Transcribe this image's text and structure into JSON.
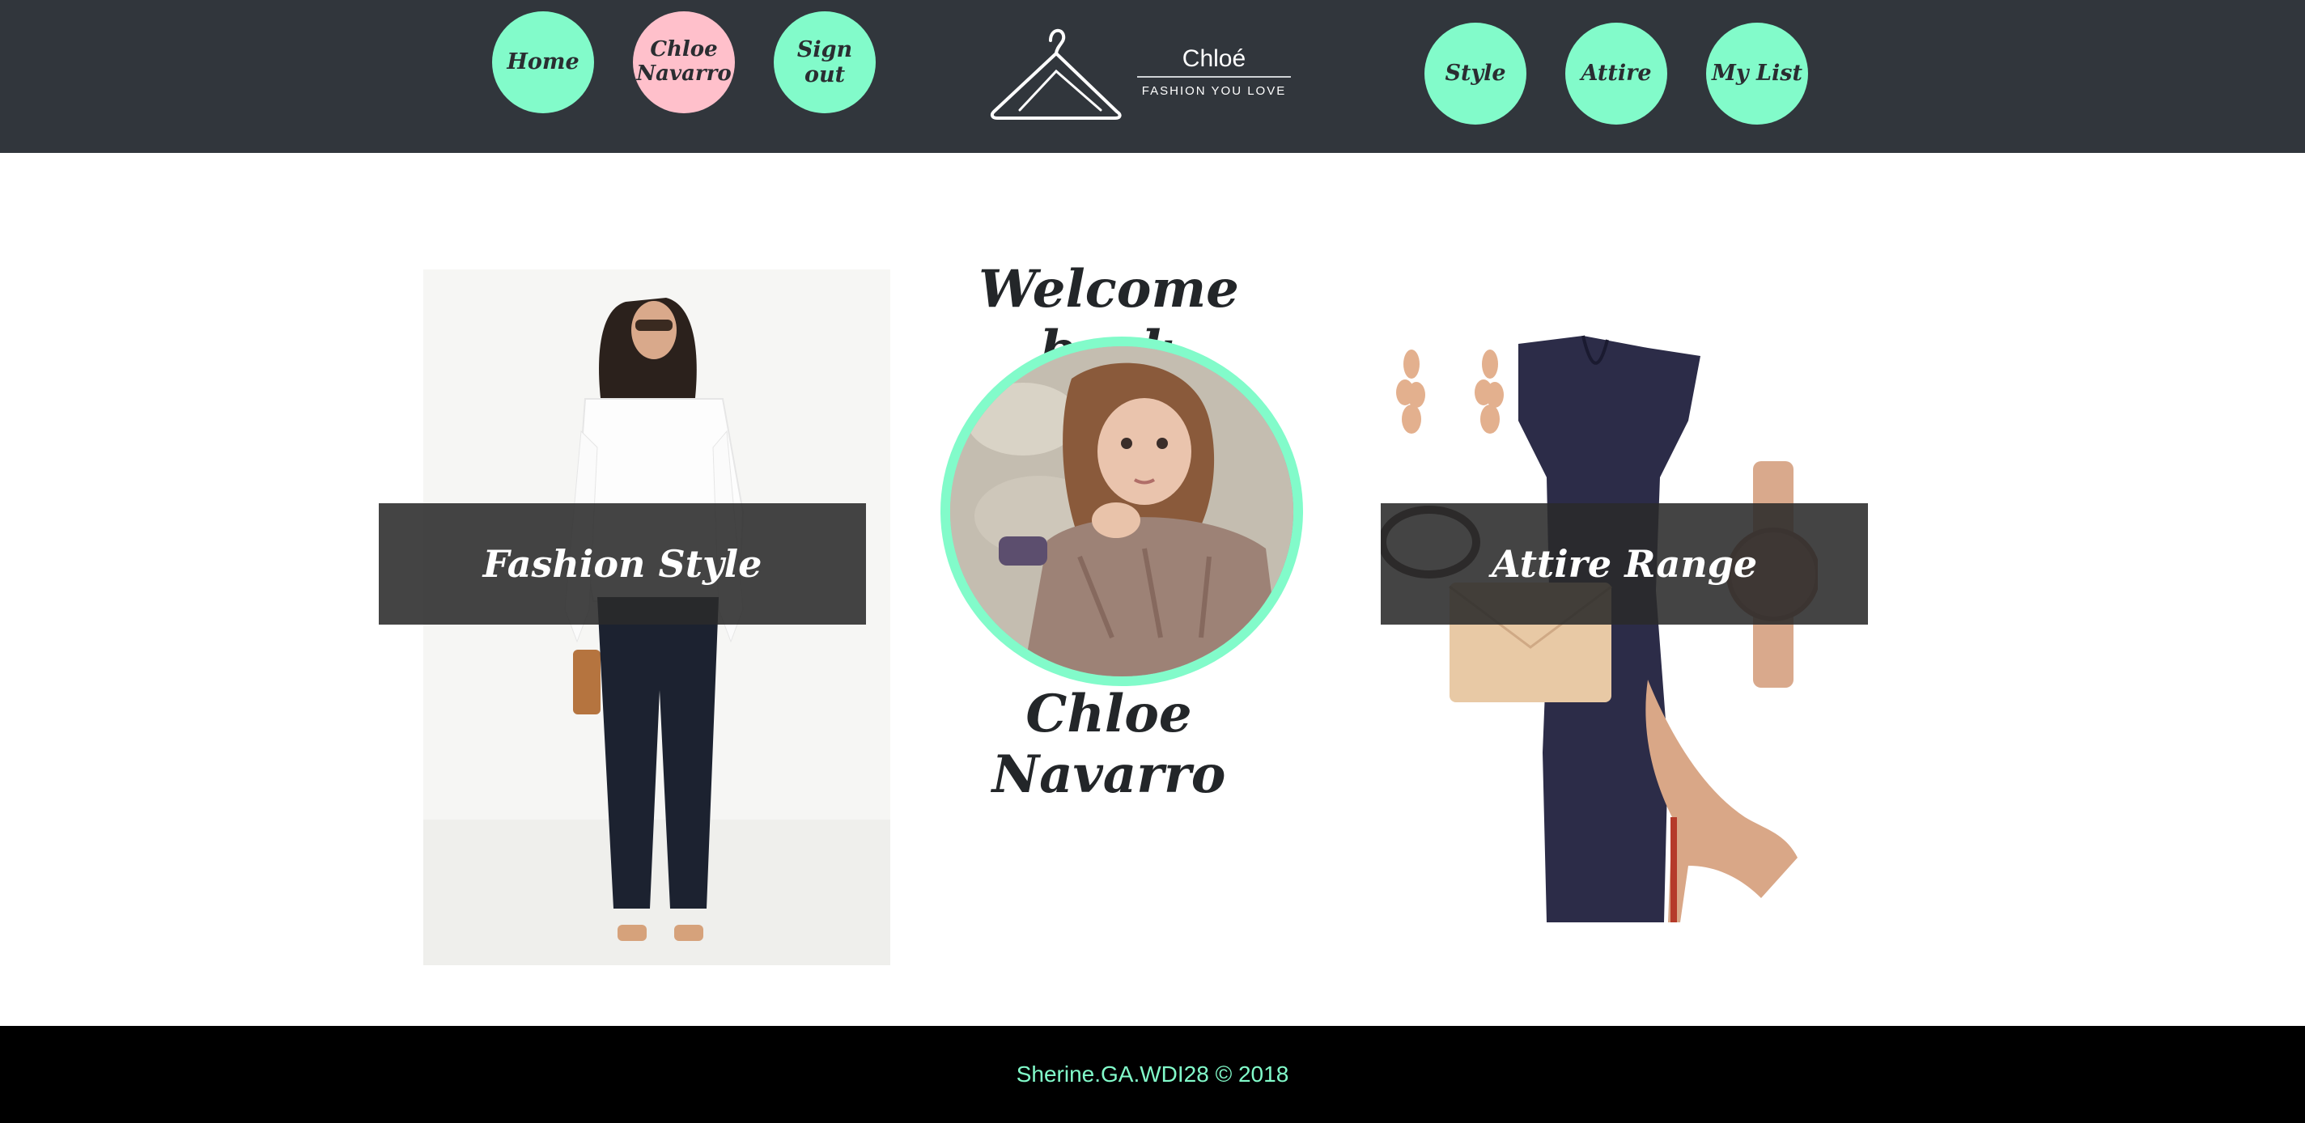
{
  "nav_left": [
    {
      "label": "Home"
    },
    {
      "label": "Chloe Navarro"
    },
    {
      "label": "Sign out"
    }
  ],
  "logo": {
    "name": "Chloé",
    "tagline": "FASHION YOU LOVE",
    "icon": "hanger-icon"
  },
  "nav_right": [
    {
      "label": "Style"
    },
    {
      "label": "Attire"
    },
    {
      "label": "My List"
    }
  ],
  "main": {
    "welcome": "Welcome back",
    "user_name": "Chloe Navarro",
    "left_panel_label": "Fashion Style",
    "right_panel_label": "Attire Range"
  },
  "footer": {
    "text": "Sherine.GA.WDI28 © 2018"
  },
  "colors": {
    "accent": "#82fbca",
    "pink": "#ffc0cb",
    "header": "#31363c",
    "footer": "#000000"
  }
}
